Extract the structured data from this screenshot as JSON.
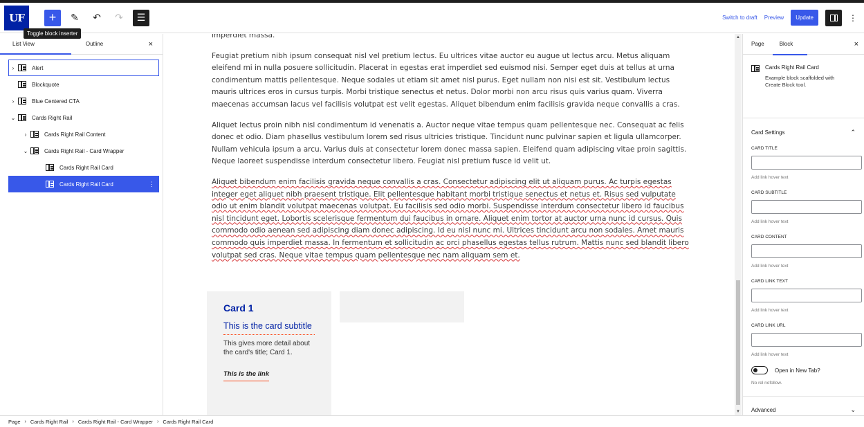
{
  "header": {
    "logo_text": "UF",
    "tooltip": "Toggle block inserter",
    "switch_to_draft": "Switch to draft",
    "preview": "Preview",
    "update": "Update",
    "icons": [
      "add-icon",
      "pencil-icon",
      "undo-icon",
      "redo-icon",
      "list-view-icon",
      "sidebar-icon",
      "kebab-icon"
    ]
  },
  "left_sidebar": {
    "tabs": [
      "List View",
      "Outline"
    ],
    "close": "×",
    "items": [
      {
        "label": "Alert",
        "chevron": "›",
        "state": "focused"
      },
      {
        "label": "Blockquote",
        "chevron": "",
        "state": ""
      },
      {
        "label": "Blue Centered CTA",
        "chevron": "›",
        "state": ""
      },
      {
        "label": "Cards Right Rail",
        "chevron": "⌄",
        "state": ""
      },
      {
        "label": "Cards Right Rail Content",
        "chevron": "›",
        "state": ""
      },
      {
        "label": "Cards Right Rail - Card Wrapper",
        "chevron": "⌄",
        "state": ""
      },
      {
        "label": "Cards Right Rail Card",
        "chevron": "",
        "state": ""
      },
      {
        "label": "Cards Right Rail Card",
        "chevron": "",
        "state": "selected"
      }
    ],
    "options": "⋮"
  },
  "canvas": {
    "paragraphs": [
      "imperdiet massa.",
      "Feugiat pretium nibh ipsum consequat nisl vel pretium lectus. Eu ultrices vitae auctor eu augue ut lectus arcu. Metus aliquam eleifend mi in nulla posuere sollicitudin. Placerat in egestas erat imperdiet sed euismod nisi. Semper eget duis at tellus at urna condimentum mattis pellentesque. Neque sodales ut etiam sit amet nisl purus. Eget nullam non nisi est sit. Vestibulum lectus mauris ultrices eros in cursus turpis. Morbi tristique senectus et netus. Dolor morbi non arcu risus quis varius quam. Viverra maecenas accumsan lacus vel facilisis volutpat est velit egestas. Aliquet bibendum enim facilisis gravida neque convallis a cras.",
      "Aliquet lectus proin nibh nisl condimentum id venenatis a. Auctor neque vitae tempus quam pellentesque nec. Consequat ac felis donec et odio. Diam phasellus vestibulum lorem sed risus ultricies tristique. Tincidunt nunc pulvinar sapien et ligula ullamcorper. Nullam vehicula ipsum a arcu. Varius duis at consectetur lorem donec massa sapien. Eleifend quam adipiscing vitae proin sagittis. Neque laoreet suspendisse interdum consectetur libero. Feugiat nisl pretium fusce id velit ut.",
      "Aliquet bibendum enim facilisis gravida neque convallis a cras. Consectetur adipiscing elit ut aliquam purus. Ac turpis egestas integer eget aliquet nibh praesent tristique. Elit pellentesque habitant morbi tristique senectus et netus et. Risus sed vulputate odio ut enim blandit volutpat maecenas volutpat. Eu facilisis sed odio morbi. Suspendisse interdum consectetur libero id faucibus nisl tincidunt eget. Lobortis scelerisque fermentum dui faucibus in ornare. Aliquet enim tortor at auctor urna nunc id cursus. Quis commodo odio aenean sed adipiscing diam donec adipiscing. Id eu nisl nunc mi. Ultrices tincidunt arcu non sodales. Amet mauris commodo quis imperdiet massa. In fermentum et sollicitudin ac orci phasellus egestas tellus rutrum. Mattis nunc sed blandit libero volutpat sed cras. Neque vitae tempus quam pellentesque nec nam aliquam sem et."
    ],
    "card": {
      "title": "Card 1",
      "subtitle": "This is the card subtitle",
      "content": "This gives more detail about the card's title; Card 1.",
      "link": "This is the link"
    }
  },
  "right_sidebar": {
    "tabs": [
      "Page",
      "Block"
    ],
    "close": "×",
    "block_title": "Cards Right Rail Card",
    "block_desc": "Example block scaffolded with Create Block tool.",
    "card_settings": "Card Settings",
    "fields": [
      {
        "label": "CARD TITLE",
        "value": "",
        "help": "Add link hover text"
      },
      {
        "label": "CARD SUBTITLE",
        "value": "",
        "help": "Add link hover text"
      },
      {
        "label": "CARD CONTENT",
        "value": "",
        "help": "Add link hover text"
      },
      {
        "label": "CARD LINK TEXT",
        "value": "",
        "help": "Add link hover text"
      },
      {
        "label": "CARD LINK URL",
        "value": "",
        "help": "Add link hover text"
      }
    ],
    "toggle_label": "Open in New Tab?",
    "nofollow": "No rel nofollow.",
    "advanced": "Advanced"
  },
  "breadcrumb": [
    "Page",
    "Cards Right Rail",
    "Cards Right Rail - Card Wrapper",
    "Cards Right Rail Card"
  ],
  "colors": {
    "accent": "#3858e9",
    "uf_blue": "#0021a5",
    "uf_orange": "#fa4616"
  }
}
